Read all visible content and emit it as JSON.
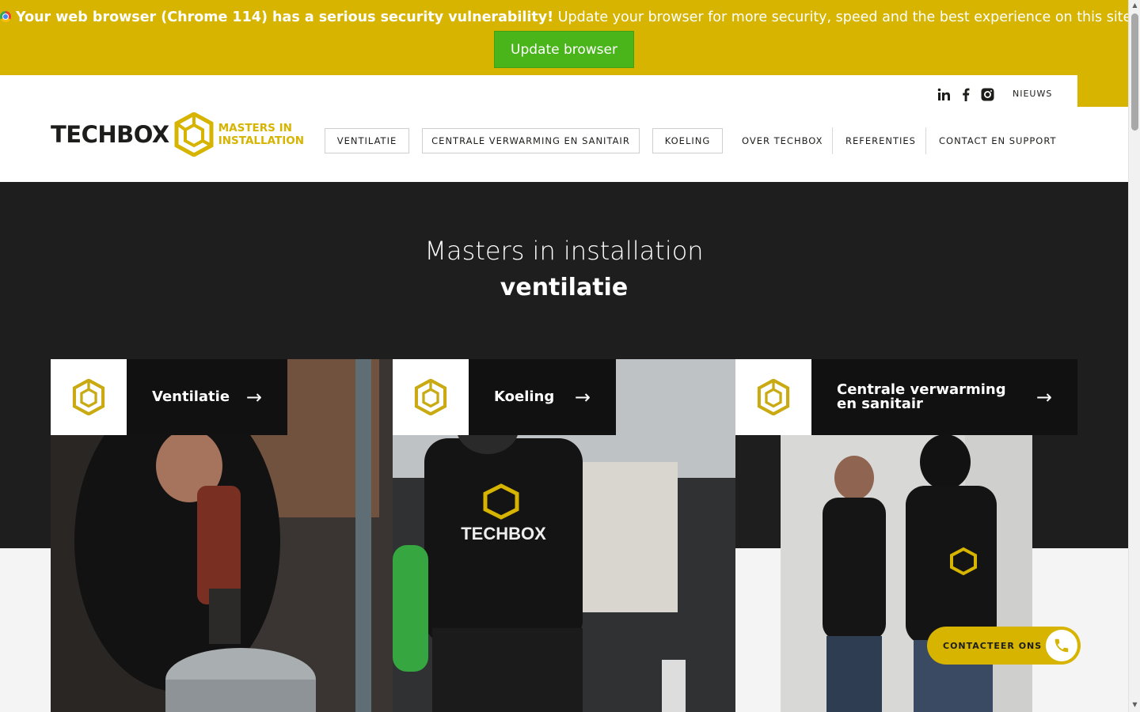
{
  "banner": {
    "bold_text": "Your web browser (Chrome 114) has a serious security vulnerability!",
    "text": " Update your browser for more security, speed and the best experience on this site.",
    "button_label": "Update browser",
    "bg_color": "#d6b400",
    "button_color": "#4ab51b"
  },
  "header": {
    "social": [
      "linkedin-icon",
      "facebook-icon",
      "instagram-icon"
    ],
    "news_label": "NIEUWS",
    "logo_word": "TECHBOX",
    "logo_tag_line1": "MASTERS IN",
    "logo_tag_line2": "INSTALLATION",
    "nav": {
      "ventilatie": "VENTILATIE",
      "cv": "CENTRALE VERWARMING EN SANITAIR",
      "koeling": "KOELING",
      "over": "OVER TECHBOX",
      "referenties": "REFERENTIES",
      "contact": "CONTACT EN SUPPORT"
    }
  },
  "hero": {
    "title": "Masters in installation",
    "subtitle": "ventilatie"
  },
  "cards": [
    {
      "label": "Ventilatie"
    },
    {
      "label": "Koeling"
    },
    {
      "label": "Centrale verwarming en sanitair"
    }
  ],
  "contact_button": {
    "label": "CONTACTEER ONS"
  },
  "colors": {
    "accent": "#d6b400",
    "dark": "#1e1e1e",
    "green": "#4ab51b"
  }
}
